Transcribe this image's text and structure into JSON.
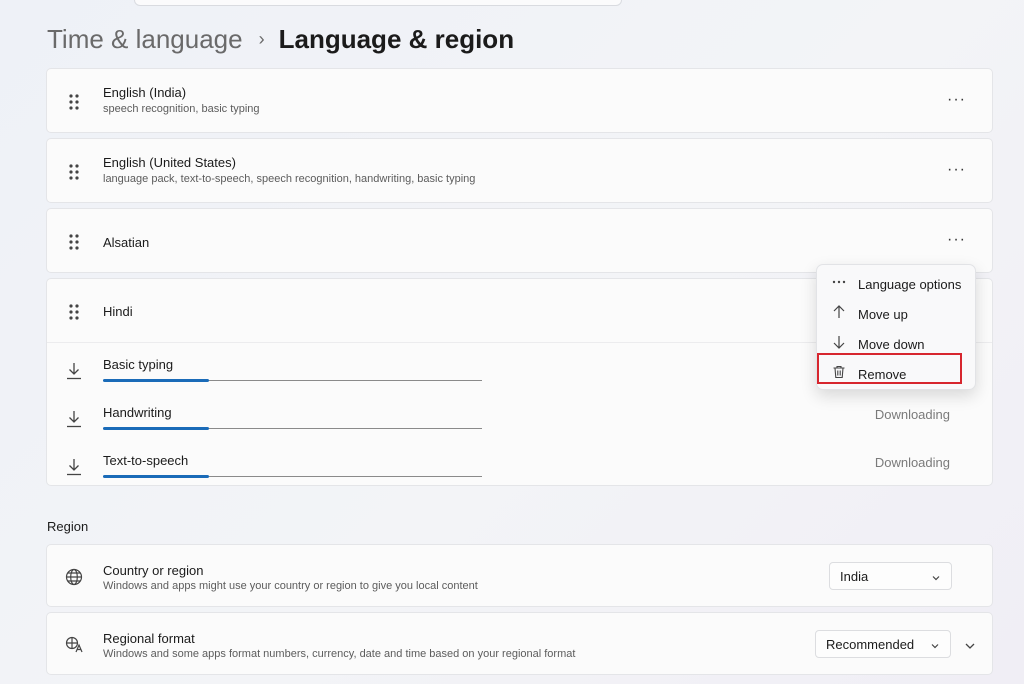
{
  "breadcrumb": {
    "parent": "Time & language",
    "separator": "›",
    "current": "Language & region"
  },
  "languages": [
    {
      "name": "English (India)",
      "features": "speech recognition, basic typing"
    },
    {
      "name": "English (United States)",
      "features": "language pack, text-to-speech, speech recognition, handwriting, basic typing"
    },
    {
      "name": "Alsatian",
      "features": ""
    },
    {
      "name": "Hindi",
      "features": ""
    }
  ],
  "more_glyph": "···",
  "downloads": [
    {
      "label": "Basic typing",
      "status": "",
      "progress": 0.28
    },
    {
      "label": "Handwriting",
      "status": "Downloading",
      "progress": 0.28
    },
    {
      "label": "Text-to-speech",
      "status": "Downloading",
      "progress": 0.28
    }
  ],
  "context_menu": {
    "items": [
      {
        "label": "Language options",
        "icon": "more-icon"
      },
      {
        "label": "Move up",
        "icon": "arrow-up-icon"
      },
      {
        "label": "Move down",
        "icon": "arrow-down-icon"
      },
      {
        "label": "Remove",
        "icon": "trash-icon"
      }
    ],
    "highlighted": "Remove",
    "highlight_color": "#d7262e"
  },
  "region": {
    "section_label": "Region",
    "country": {
      "title": "Country or region",
      "subtitle": "Windows and apps might use your country or region to give you local content",
      "value": "India",
      "icon": "globe-icon"
    },
    "format": {
      "title": "Regional format",
      "subtitle": "Windows and some apps format numbers, currency, date and time based on your regional format",
      "value": "Recommended",
      "icon": "regional-format-icon"
    }
  },
  "colors": {
    "accent": "#1a6bb8"
  }
}
